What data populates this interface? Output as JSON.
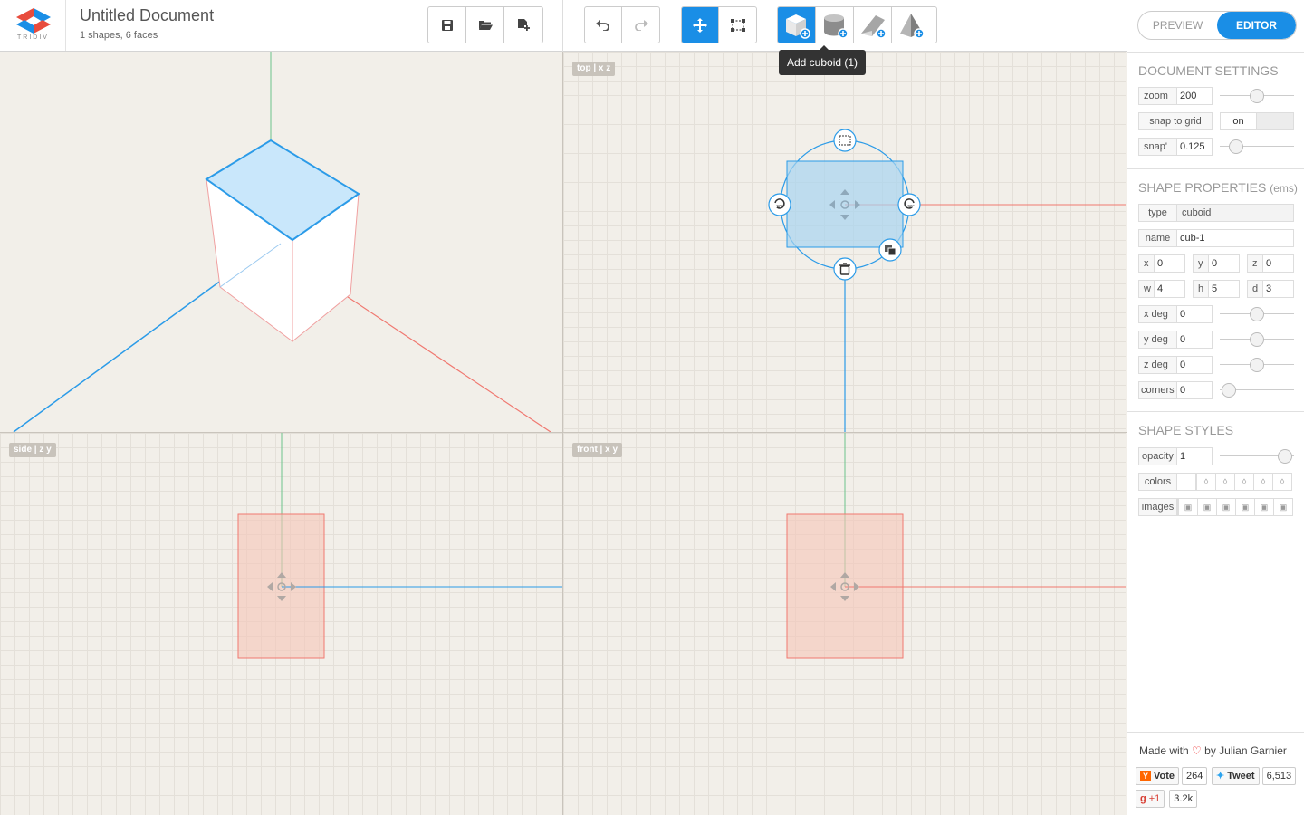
{
  "app": {
    "logo_text": "TRIDIV",
    "doc_title": "Untitled Document",
    "doc_subtitle": "1 shapes, 6 faces"
  },
  "toolbar": {
    "tooltip": "Add cuboid (1)",
    "file_icons": [
      "save-icon",
      "open-folder-icon",
      "new-document-icon"
    ],
    "history_icons": [
      "undo-icon",
      "redo-icon"
    ],
    "tool_icons": [
      "move-icon",
      "select-rect-icon"
    ],
    "shape_icons": [
      "add-cuboid-icon",
      "add-cylinder-icon",
      "add-prism-icon",
      "add-pyramid-icon"
    ],
    "accent": "#1a8ee6"
  },
  "viewports": {
    "top_label": "top | x z",
    "side_label": "side | z y",
    "front_label": "front | x y"
  },
  "panel": {
    "mode_preview": "PREVIEW",
    "mode_editor": "EDITOR",
    "doc_settings_title": "DOCUMENT SETTINGS",
    "zoom_label": "zoom",
    "zoom_value": "200",
    "zoom_level": 0.5,
    "snap_grid_label": "snap to grid",
    "snap_grid_value": "on",
    "snap_label": "snap'",
    "snap_value": "0.125",
    "snap_level": 0.15,
    "shape_props_title": "SHAPE PROPERTIES",
    "shape_props_units": "(ems)",
    "type_label": "type",
    "type_value": "cuboid",
    "name_label": "name",
    "name_value": "cub-1",
    "x_label": "x",
    "x_value": "0",
    "y_label": "y",
    "y_value": "0",
    "z_label": "z",
    "z_value": "0",
    "w_label": "w",
    "w_value": "4",
    "h_label": "h",
    "h_value": "5",
    "d_label": "d",
    "d_value": "3",
    "xdeg_label": "x deg",
    "xdeg_value": "0",
    "ydeg_label": "y deg",
    "ydeg_value": "0",
    "zdeg_label": "z deg",
    "zdeg_value": "0",
    "corners_label": "corners",
    "corners_value": "0",
    "shape_styles_title": "SHAPE STYLES",
    "opacity_label": "opacity",
    "opacity_value": "1",
    "colors_label": "colors",
    "images_label": "images"
  },
  "footer": {
    "made_with": "Made with",
    "by": "by Julian Garnier",
    "vote_label": "Vote",
    "vote_count": "264",
    "tweet_label": "Tweet",
    "tweet_count": "6,513",
    "gplus_label": "+1",
    "gplus_count": "3.2k"
  }
}
